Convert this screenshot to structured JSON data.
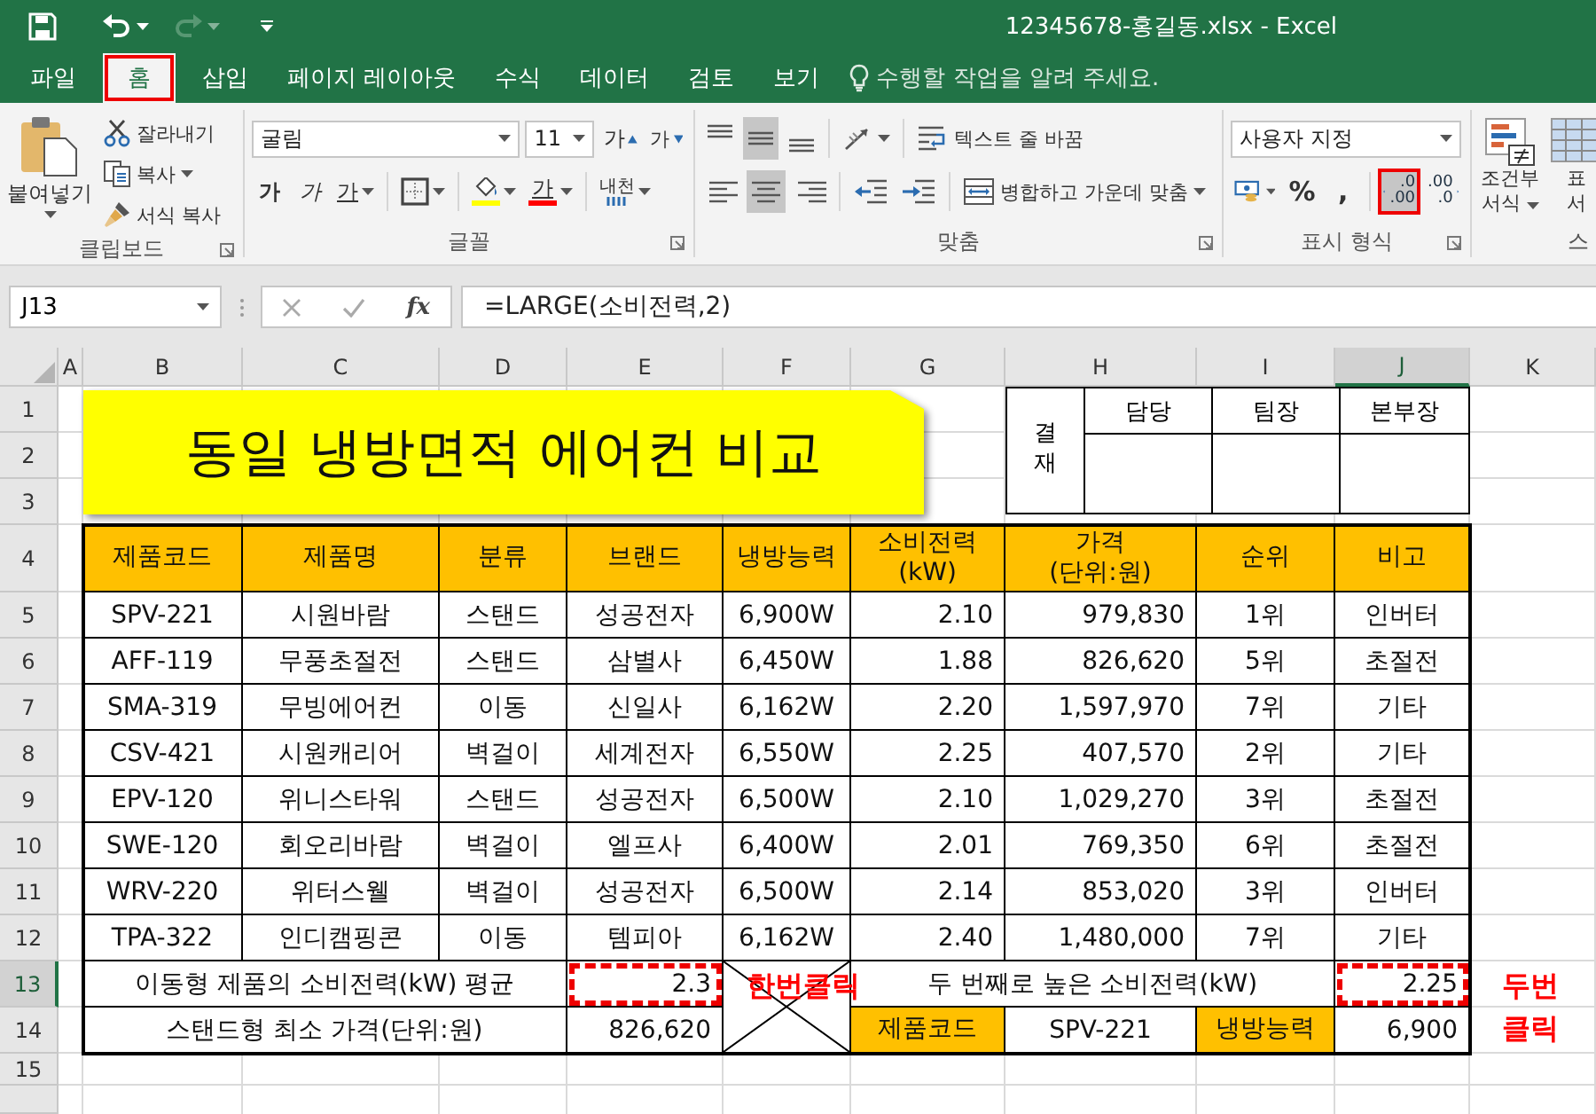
{
  "title_bar": {
    "title": "12345678-홍길동.xlsx - Excel"
  },
  "tabs": [
    {
      "label": "파일",
      "selected": false
    },
    {
      "label": "홈",
      "selected": true
    },
    {
      "label": "삽입",
      "selected": false
    },
    {
      "label": "페이지 레이아웃",
      "selected": false
    },
    {
      "label": "수식",
      "selected": false
    },
    {
      "label": "데이터",
      "selected": false
    },
    {
      "label": "검토",
      "selected": false
    },
    {
      "label": "보기",
      "selected": false
    }
  ],
  "tell_me": {
    "placeholder": "수행할 작업을 알려 주세요."
  },
  "clipboard": {
    "paste": "붙여넣기",
    "cut": "잘라내기",
    "copy": "복사",
    "format_painter": "서식 복사",
    "label": "클립보드"
  },
  "font": {
    "name": "굴림",
    "size": "11",
    "grow": "가",
    "shrink": "가",
    "styles": [
      {
        "kind": "bold",
        "label": "가"
      },
      {
        "kind": "italic",
        "label": "가"
      },
      {
        "kind": "underline",
        "label": "가"
      }
    ],
    "font_color": "가",
    "phonetic": "내천",
    "label": "글꼴"
  },
  "alignment": {
    "vertical": [
      {
        "kind": "top",
        "selected": false
      },
      {
        "kind": "middle",
        "selected": true
      },
      {
        "kind": "bottom",
        "selected": false
      }
    ],
    "horizontal": [
      {
        "kind": "left",
        "selected": false
      },
      {
        "kind": "center",
        "selected": true
      },
      {
        "kind": "right",
        "selected": false
      }
    ],
    "wrap_text": "텍스트 줄 바꿈",
    "merge_center": "병합하고 가운데 맞춤",
    "label": "맞춤"
  },
  "number": {
    "format": "사용자 지정",
    "percent": "%",
    "comma": ",",
    "decimals": [
      {
        "kind": "increase",
        "top": ".0",
        "bottom": ".00",
        "highlighted": true
      },
      {
        "kind": "decrease",
        "top": ".00",
        "bottom": ".0",
        "highlighted": false
      }
    ],
    "label": "표시 형식"
  },
  "styles": {
    "conditional_format": [
      "조건부",
      "서식"
    ],
    "format_table": [
      "표",
      "서"
    ],
    "label": "스"
  },
  "formula_bar": {
    "name_box": "J13",
    "fx": "fx",
    "formula": "=LARGE(소비전력,2)"
  },
  "sheet": {
    "columns": [
      {
        "label": "A",
        "selected": false
      },
      {
        "label": "B",
        "selected": false
      },
      {
        "label": "C",
        "selected": false
      },
      {
        "label": "D",
        "selected": false
      },
      {
        "label": "E",
        "selected": false
      },
      {
        "label": "F",
        "selected": false
      },
      {
        "label": "G",
        "selected": false
      },
      {
        "label": "H",
        "selected": false
      },
      {
        "label": "I",
        "selected": false
      },
      {
        "label": "J",
        "selected": true
      },
      {
        "label": "K",
        "selected": false
      }
    ],
    "rows": [
      {
        "label": "1",
        "selected": false
      },
      {
        "label": "2",
        "selected": false
      },
      {
        "label": "3",
        "selected": false
      },
      {
        "label": "4",
        "selected": false
      },
      {
        "label": "5",
        "selected": false
      },
      {
        "label": "6",
        "selected": false
      },
      {
        "label": "7",
        "selected": false
      },
      {
        "label": "8",
        "selected": false
      },
      {
        "label": "9",
        "selected": false
      },
      {
        "label": "10",
        "selected": false
      },
      {
        "label": "11",
        "selected": false
      },
      {
        "label": "12",
        "selected": false
      },
      {
        "label": "13",
        "selected": true
      },
      {
        "label": "14",
        "selected": false
      },
      {
        "label": "15",
        "selected": false
      }
    ],
    "title": "동일 냉방면적 에어컨 비교",
    "approval": {
      "label": "결재",
      "roles": [
        "담당",
        "팀장",
        "본부장"
      ]
    },
    "table": {
      "columns": [
        "제품코드",
        "제품명",
        "분류",
        "브랜드",
        "냉방능력",
        "소비전력\n(kW)",
        "가격\n(단위:원)",
        "순위",
        "비고"
      ],
      "rows": [
        [
          "SPV-221",
          "시원바람",
          "스탠드",
          "성공전자",
          "6,900W",
          "2.10",
          "979,830",
          "1위",
          "인버터"
        ],
        [
          "AFF-119",
          "무풍초절전",
          "스탠드",
          "삼별사",
          "6,450W",
          "1.88",
          "826,620",
          "5위",
          "초절전"
        ],
        [
          "SMA-319",
          "무빙에어컨",
          "이동",
          "신일사",
          "6,162W",
          "2.20",
          "1,597,970",
          "7위",
          "기타"
        ],
        [
          "CSV-421",
          "시원캐리어",
          "벽걸이",
          "세계전자",
          "6,550W",
          "2.25",
          "407,570",
          "2위",
          "기타"
        ],
        [
          "EPV-120",
          "위니스타워",
          "스탠드",
          "성공전자",
          "6,500W",
          "2.10",
          "1,029,270",
          "3위",
          "초절전"
        ],
        [
          "SWE-120",
          "회오리바람",
          "벽걸이",
          "엘프사",
          "6,400W",
          "2.01",
          "769,350",
          "6위",
          "초절전"
        ],
        [
          "WRV-220",
          "위터스웰",
          "벽걸이",
          "성공전자",
          "6,500W",
          "2.14",
          "853,020",
          "3위",
          "인버터"
        ],
        [
          "TPA-322",
          "인디캠핑콘",
          "이동",
          "템피아",
          "6,162W",
          "2.40",
          "1,480,000",
          "7위",
          "기타"
        ]
      ]
    },
    "summary": {
      "avg_label": "이동형 제품의 소비전력(kW) 평균",
      "avg_value": {
        "text": "2.3",
        "highlighted": true
      },
      "second_label": "두 번째로 높은 소비전력(kW)",
      "second_value": {
        "text": "2.25",
        "highlighted": true
      },
      "min_label": "스탠드형 최소 가격(단위:원)",
      "min_value": {
        "text": "826,620",
        "highlighted": false
      },
      "lookup": [
        {
          "kind": "header",
          "text": "제품코드"
        },
        {
          "kind": "value",
          "text": "SPV-221"
        },
        {
          "kind": "header",
          "text": "냉방능력"
        },
        {
          "kind": "value",
          "text": "6,900"
        }
      ]
    },
    "callouts": {
      "single_click": "한번클릭",
      "double_click": [
        "두번",
        "클릭"
      ]
    }
  }
}
